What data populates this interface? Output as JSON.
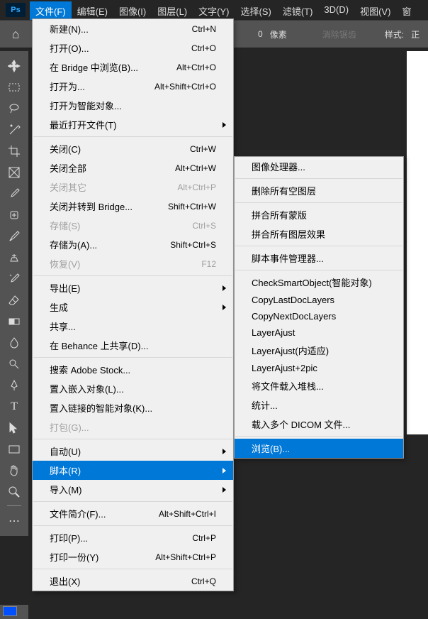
{
  "logo": "Ps",
  "menubar": [
    {
      "label": "文件(F)",
      "active": true
    },
    {
      "label": "编辑(E)"
    },
    {
      "label": "图像(I)"
    },
    {
      "label": "图层(L)"
    },
    {
      "label": "文字(Y)"
    },
    {
      "label": "选择(S)"
    },
    {
      "label": "滤镜(T)"
    },
    {
      "label": "3D(D)"
    },
    {
      "label": "视图(V)"
    },
    {
      "label": "窗"
    }
  ],
  "options": {
    "px_value": "0",
    "px_unit": "像素",
    "anti_alias": "消除锯齿",
    "style": "样式:",
    "style_value": "正"
  },
  "file_menu": [
    {
      "label": "新建(N)...",
      "shortcut": "Ctrl+N"
    },
    {
      "label": "打开(O)...",
      "shortcut": "Ctrl+O"
    },
    {
      "label": "在 Bridge 中浏览(B)...",
      "shortcut": "Alt+Ctrl+O"
    },
    {
      "label": "打开为...",
      "shortcut": "Alt+Shift+Ctrl+O"
    },
    {
      "label": "打开为智能对象..."
    },
    {
      "label": "最近打开文件(T)",
      "arrow": true
    },
    {
      "sep": true
    },
    {
      "label": "关闭(C)",
      "shortcut": "Ctrl+W"
    },
    {
      "label": "关闭全部",
      "shortcut": "Alt+Ctrl+W"
    },
    {
      "label": "关闭其它",
      "shortcut": "Alt+Ctrl+P",
      "disabled": true
    },
    {
      "label": "关闭并转到 Bridge...",
      "shortcut": "Shift+Ctrl+W"
    },
    {
      "label": "存储(S)",
      "shortcut": "Ctrl+S",
      "disabled": true
    },
    {
      "label": "存储为(A)...",
      "shortcut": "Shift+Ctrl+S"
    },
    {
      "label": "恢复(V)",
      "shortcut": "F12",
      "disabled": true
    },
    {
      "sep": true
    },
    {
      "label": "导出(E)",
      "arrow": true
    },
    {
      "label": "生成",
      "arrow": true
    },
    {
      "label": "共享..."
    },
    {
      "label": "在 Behance 上共享(D)..."
    },
    {
      "sep": true
    },
    {
      "label": "搜索 Adobe Stock..."
    },
    {
      "label": "置入嵌入对象(L)..."
    },
    {
      "label": "置入链接的智能对象(K)..."
    },
    {
      "label": "打包(G)...",
      "disabled": true
    },
    {
      "sep": true
    },
    {
      "label": "自动(U)",
      "arrow": true
    },
    {
      "label": "脚本(R)",
      "arrow": true,
      "highlight": true
    },
    {
      "label": "导入(M)",
      "arrow": true
    },
    {
      "sep": true
    },
    {
      "label": "文件简介(F)...",
      "shortcut": "Alt+Shift+Ctrl+I"
    },
    {
      "sep": true
    },
    {
      "label": "打印(P)...",
      "shortcut": "Ctrl+P"
    },
    {
      "label": "打印一份(Y)",
      "shortcut": "Alt+Shift+Ctrl+P"
    },
    {
      "sep": true
    },
    {
      "label": "退出(X)",
      "shortcut": "Ctrl+Q"
    }
  ],
  "script_menu": [
    {
      "label": "图像处理器..."
    },
    {
      "sep": true
    },
    {
      "label": "删除所有空图层"
    },
    {
      "sep": true
    },
    {
      "label": "拼合所有蒙版"
    },
    {
      "label": "拼合所有图层效果"
    },
    {
      "sep": true
    },
    {
      "label": "脚本事件管理器..."
    },
    {
      "sep": true
    },
    {
      "label": "CheckSmartObject(智能对象)"
    },
    {
      "label": "CopyLastDocLayers"
    },
    {
      "label": "CopyNextDocLayers"
    },
    {
      "label": "LayerAjust"
    },
    {
      "label": "LayerAjust(内适应)"
    },
    {
      "label": "LayerAjust+2pic"
    },
    {
      "label": "将文件载入堆栈..."
    },
    {
      "label": "统计..."
    },
    {
      "label": "载入多个 DICOM 文件..."
    },
    {
      "sep": true
    },
    {
      "label": "浏览(B)...",
      "highlight": true
    }
  ]
}
